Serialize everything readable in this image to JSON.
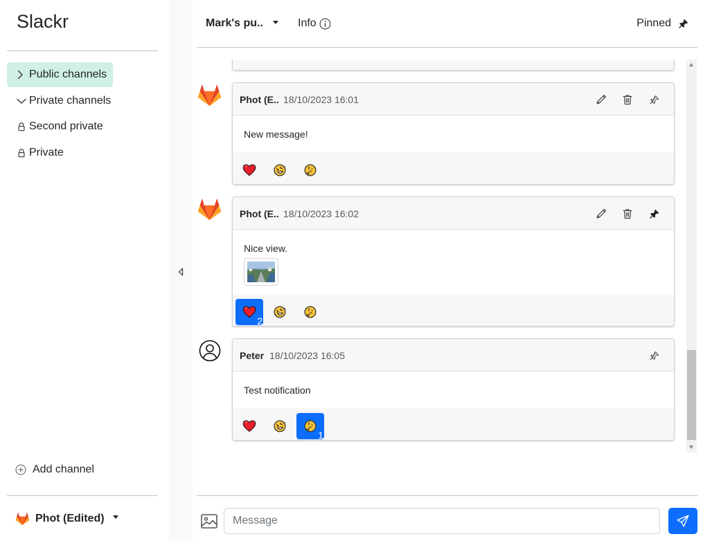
{
  "app": {
    "title": "Slackr"
  },
  "sidebar": {
    "items": [
      {
        "label": "Public channels",
        "icon": "chevron-right-icon",
        "active": true
      },
      {
        "label": "Private channels",
        "icon": "chevron-down-icon",
        "active": false
      },
      {
        "label": "Second private",
        "icon": "lock-icon",
        "active": false
      },
      {
        "label": "Private",
        "icon": "lock-icon",
        "active": false
      }
    ],
    "add_channel": "Add channel",
    "user": {
      "name": "Phot (Edited)",
      "icon": "gitlab-fox-icon"
    }
  },
  "header": {
    "channel_name": "Mark's pu..",
    "info_label": "Info",
    "pinned_label": "Pinned"
  },
  "messages": [
    {
      "author": "Phot (E..",
      "time": "18/10/2023 16:01",
      "text": "New message!",
      "avatar": "gitlab-fox-icon",
      "can_edit": true,
      "pinned": false,
      "reactions": [
        {
          "emoji": "heart-icon",
          "count": "",
          "selected": false
        },
        {
          "emoji": "laughing-face-icon",
          "count": "",
          "selected": false
        },
        {
          "emoji": "thinking-face-icon",
          "count": "",
          "selected": false
        }
      ]
    },
    {
      "author": "Phot (E..",
      "time": "18/10/2023 16:02",
      "text": "Nice view.",
      "avatar": "gitlab-fox-icon",
      "has_image": true,
      "can_edit": true,
      "pinned": true,
      "reactions": [
        {
          "emoji": "heart-icon",
          "count": "2",
          "selected": true
        },
        {
          "emoji": "laughing-face-icon",
          "count": "",
          "selected": false
        },
        {
          "emoji": "thinking-face-icon",
          "count": "",
          "selected": false
        }
      ]
    },
    {
      "author": "Peter",
      "time": "18/10/2023 16:05",
      "text": "Test notification",
      "avatar": "user-circle-icon",
      "can_edit": false,
      "pinned": false,
      "reactions": [
        {
          "emoji": "heart-icon",
          "count": "",
          "selected": false
        },
        {
          "emoji": "laughing-face-icon",
          "count": "",
          "selected": false
        },
        {
          "emoji": "thinking-face-icon",
          "count": "1",
          "selected": true
        }
      ]
    }
  ],
  "composer": {
    "placeholder": "Message"
  },
  "colors": {
    "accent": "#0d6efd",
    "active_channel_bg": "#d1f0e5",
    "header_bg": "#f7f7f7"
  }
}
